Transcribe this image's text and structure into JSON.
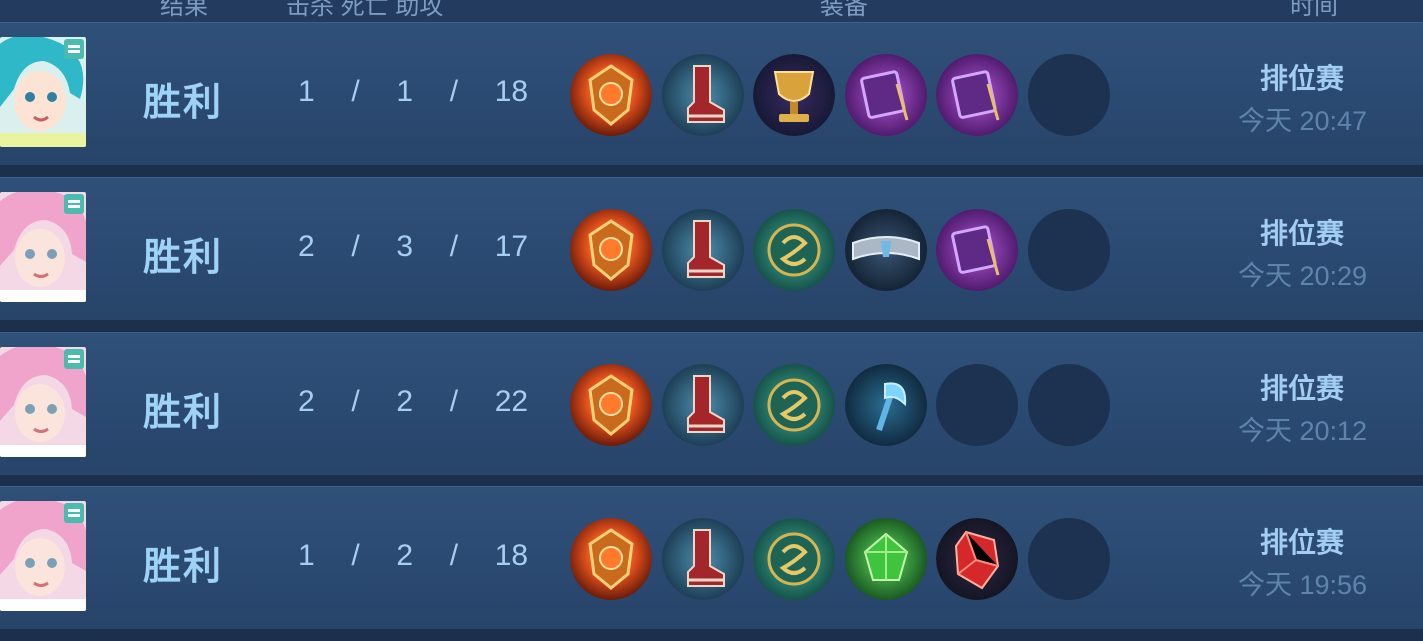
{
  "header": {
    "col_result": "结果",
    "col_kda": "击杀 死亡 助攻",
    "col_items": "装备",
    "col_time": "时间"
  },
  "matches": [
    {
      "hero_icon": "hero-portrait-teal-hair",
      "result": "胜利",
      "kda": "1  /  1  /  18",
      "items": [
        "fire-medallion-icon",
        "red-boots-icon",
        "golden-chalice-icon",
        "purple-tome-icon",
        "purple-tome-icon",
        "empty-slot"
      ],
      "mode": "排位赛",
      "time": "今天 20:47"
    },
    {
      "hero_icon": "hero-portrait-pink-hair",
      "result": "胜利",
      "kda": "2  /  3  /  17",
      "items": [
        "fire-medallion-icon",
        "red-boots-icon",
        "green-serpent-icon",
        "silver-bracer-icon",
        "purple-tome-icon",
        "empty-slot"
      ],
      "mode": "排位赛",
      "time": "今天 20:29"
    },
    {
      "hero_icon": "hero-portrait-pink-hair",
      "result": "胜利",
      "kda": "2  /  2  /  22",
      "items": [
        "fire-medallion-icon",
        "red-boots-icon",
        "green-serpent-icon",
        "ice-scepter-icon",
        "empty-slot",
        "empty-slot"
      ],
      "mode": "排位赛",
      "time": "今天 20:12"
    },
    {
      "hero_icon": "hero-portrait-pink-hair",
      "result": "胜利",
      "kda": "1  /  2  /  18",
      "items": [
        "fire-medallion-icon",
        "red-boots-icon",
        "green-serpent-icon",
        "green-gem-icon",
        "red-crystal-icon",
        "empty-slot"
      ],
      "mode": "排位赛",
      "time": "今天 19:56"
    }
  ],
  "colors": {
    "row_bg": "#2c4b73",
    "result_text": "#9fd2f7",
    "kda_text": "#a7cdf0",
    "time_text": "#5f84ab",
    "empty_slot": "#1c3250"
  }
}
